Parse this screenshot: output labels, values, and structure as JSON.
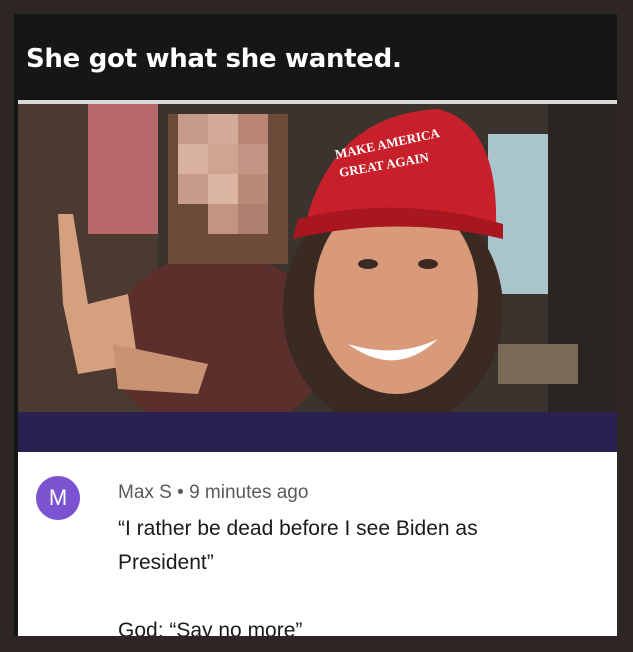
{
  "post": {
    "caption": "She got what she wanted."
  },
  "photo": {
    "hat_text_line1": "MAKE AMERICA",
    "hat_text_line2": "GREAT AGAIN",
    "colors": {
      "hat": "#c8202b",
      "skin": "#d89a78",
      "background": "#3d3631"
    }
  },
  "comment": {
    "avatar_letter": "M",
    "author": "Max S",
    "separator": "•",
    "time": "9 minutes ago",
    "line1": "“I rather be dead before I see Biden as",
    "line2": "President”",
    "line3": "God: “Say no more”",
    "avatar_color": "#7b53d0"
  }
}
